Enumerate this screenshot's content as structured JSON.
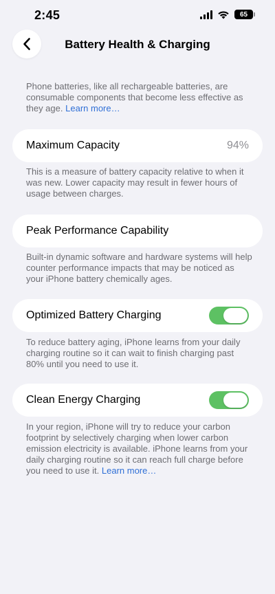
{
  "status_bar": {
    "time": "2:45",
    "battery_level": "65"
  },
  "nav": {
    "back_icon": "chevron-left-icon",
    "title": "Battery Health & Charging"
  },
  "intro": {
    "text": "Phone batteries, like all rechargeable batteries, are consumable components that become less effective as they age.",
    "link": "Learn more…"
  },
  "maximum_capacity": {
    "label": "Maximum Capacity",
    "value": "94%",
    "footnote": "This is a measure of battery capacity relative to when it was new. Lower capacity may result in fewer hours of usage between charges."
  },
  "peak_performance": {
    "label": "Peak Performance Capability",
    "footnote": "Built-in dynamic software and hardware systems will help counter performance impacts that may be noticed as your iPhone battery chemically ages."
  },
  "optimized_charging": {
    "label": "Optimized Battery Charging",
    "enabled": true,
    "footnote": "To reduce battery aging, iPhone learns from your daily charging routine so it can wait to finish charging past 80% until you need to use it."
  },
  "clean_energy": {
    "label": "Clean Energy Charging",
    "enabled": true,
    "footnote": "In your region, iPhone will try to reduce your carbon footprint by selectively charging when lower carbon emission electricity is available. iPhone learns from your daily charging routine so it can reach full charge before you need to use it.",
    "link": "Learn more…"
  },
  "colors": {
    "background": "#F2F2F7",
    "card": "#FFFFFF",
    "toggle_on": "#5DC163",
    "link": "#2F6FD6",
    "secondary_text": "#6D6D72"
  }
}
